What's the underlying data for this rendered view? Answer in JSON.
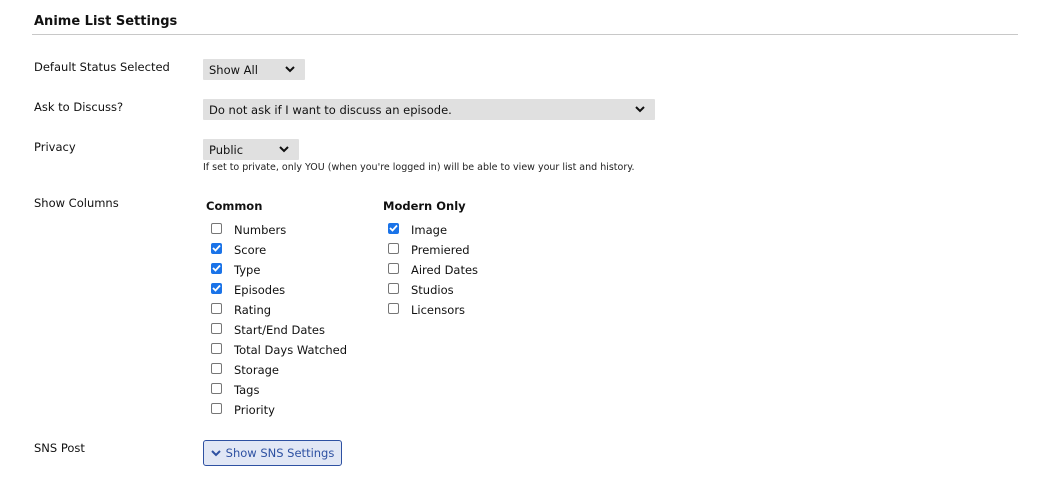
{
  "section": {
    "title": "Anime List Settings"
  },
  "default_status": {
    "label": "Default Status Selected",
    "value": "Show All"
  },
  "discuss": {
    "label": "Ask to Discuss?",
    "value": "Do not ask if I want to discuss an episode."
  },
  "privacy": {
    "label": "Privacy",
    "value": "Public",
    "note": "If set to private, only YOU (when you're logged in) will be able to view your list and history."
  },
  "columns": {
    "label": "Show Columns",
    "common": {
      "heading": "Common",
      "items": [
        {
          "label": "Numbers",
          "checked": false
        },
        {
          "label": "Score",
          "checked": true
        },
        {
          "label": "Type",
          "checked": true
        },
        {
          "label": "Episodes",
          "checked": true
        },
        {
          "label": "Rating",
          "checked": false
        },
        {
          "label": "Start/End Dates",
          "checked": false
        },
        {
          "label": "Total Days Watched",
          "checked": false
        },
        {
          "label": "Storage",
          "checked": false
        },
        {
          "label": "Tags",
          "checked": false
        },
        {
          "label": "Priority",
          "checked": false
        }
      ]
    },
    "modern": {
      "heading": "Modern Only",
      "items": [
        {
          "label": "Image",
          "checked": true
        },
        {
          "label": "Premiered",
          "checked": false
        },
        {
          "label": "Aired Dates",
          "checked": false
        },
        {
          "label": "Studios",
          "checked": false
        },
        {
          "label": "Licensors",
          "checked": false
        }
      ]
    }
  },
  "sns": {
    "label": "SNS Post",
    "button_label": "Show SNS Settings"
  },
  "colors": {
    "accent": "#2e51a2",
    "checkbox_checked": "#1a73e8",
    "select_bg": "#e0e0e0"
  }
}
